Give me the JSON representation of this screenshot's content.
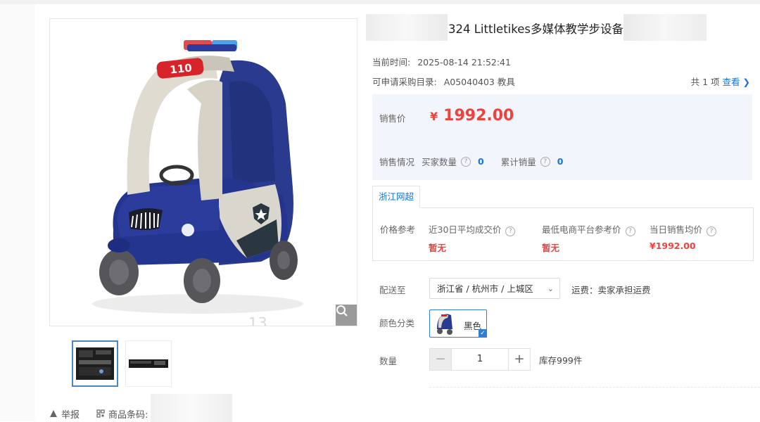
{
  "product": {
    "title": "324 Littletikes多媒体教学步设备",
    "current_time_label": "当前时间:",
    "current_time": "2025-08-14 21:52:41",
    "catalog_label": "可申请采购目录:",
    "catalog_value": "A05040403 教具",
    "catalog_count": "共 1 项",
    "catalog_view_link": "查看",
    "image_watermark": "13"
  },
  "price": {
    "label": "销售价",
    "symbol": "¥",
    "value": "1992.00"
  },
  "sales": {
    "label": "销售情况",
    "buyers_label": "买家数量",
    "buyers_value": "0",
    "total_label": "累计销量",
    "total_value": "0"
  },
  "reference": {
    "tab": "浙江网超",
    "label": "价格参考",
    "columns": [
      {
        "label": "近30日平均成交价",
        "value": "暂无"
      },
      {
        "label": "最低电商平台参考价",
        "value": "暂无"
      },
      {
        "label": "当日销售均价",
        "value": "¥1992.00"
      }
    ]
  },
  "shipping": {
    "label": "配送至",
    "selected": "浙江省 / 杭州市 / 上城区",
    "freight": "运费：卖家承担运费"
  },
  "color": {
    "label": "颜色分类",
    "option": "黑色"
  },
  "quantity": {
    "label": "数量",
    "minus": "−",
    "value": "1",
    "plus": "+",
    "stock": "库存999件"
  },
  "footer": {
    "report": "举报",
    "barcode": "商品条码:"
  },
  "icons": {
    "zoom": "search-icon",
    "report": "warning-icon",
    "barcode": "barcode-icon"
  },
  "colors": {
    "price_red": "#f0413b",
    "link_blue": "#1a73d9",
    "price_bg": "#f2f6fc"
  }
}
